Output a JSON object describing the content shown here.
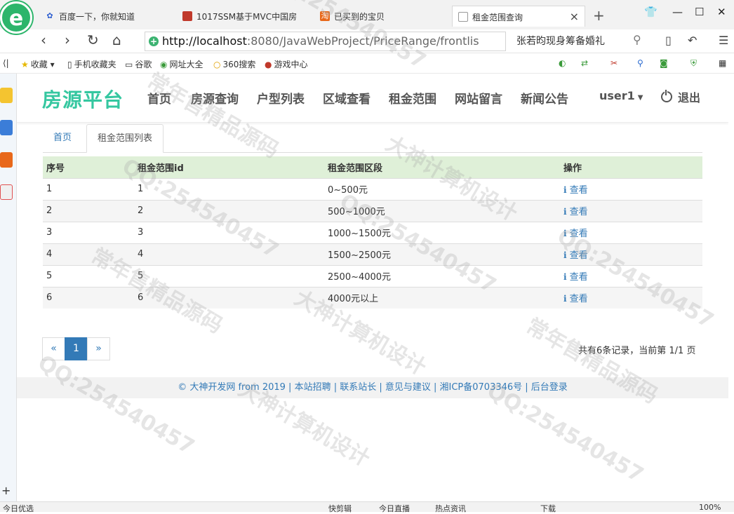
{
  "browser": {
    "tabs": [
      {
        "title": "百度一下，你就知道",
        "icon": "baidu-paw-icon"
      },
      {
        "title": "1017SSM基于MVC中国房",
        "icon": "red-square-icon"
      },
      {
        "title": "已买到的宝贝",
        "icon": "taobao-icon"
      },
      {
        "title": "租金范围查询",
        "icon": "page-icon"
      }
    ],
    "url_host": "http://localhost",
    "url_rest": ":8080/JavaWebProject/PriceRange/frontlis",
    "search_text": "张若昀现身筹备婚礼",
    "bookmarks": [
      "收藏",
      "手机收藏夹",
      "谷歌",
      "网址大全",
      "360搜索",
      "游戏中心"
    ],
    "status": [
      "今日优选",
      "快剪辑",
      "今日直播",
      "热点资讯",
      "下载",
      "100%"
    ]
  },
  "site": {
    "brand": "房源平台",
    "menu": [
      "首页",
      "房源查询",
      "户型列表",
      "区域查看",
      "租金范围",
      "网站留言",
      "新闻公告"
    ],
    "user": "user1",
    "logout": "退出"
  },
  "breadcrumb": {
    "home": "首页",
    "current": "租金范围列表"
  },
  "table": {
    "headers": [
      "序号",
      "租金范围id",
      "租金范围区段",
      "操作"
    ],
    "rows": [
      {
        "no": "1",
        "id": "1",
        "range": "0~500元",
        "action": "查看"
      },
      {
        "no": "2",
        "id": "2",
        "range": "500~1000元",
        "action": "查看"
      },
      {
        "no": "3",
        "id": "3",
        "range": "1000~1500元",
        "action": "查看"
      },
      {
        "no": "4",
        "id": "4",
        "range": "1500~2500元",
        "action": "查看"
      },
      {
        "no": "5",
        "id": "5",
        "range": "2500~4000元",
        "action": "查看"
      },
      {
        "no": "6",
        "id": "6",
        "range": "4000元以上",
        "action": "查看"
      }
    ]
  },
  "pagination": {
    "prev": "«",
    "current": "1",
    "next": "»",
    "summary": "共有6条记录，当前第 1/1 页"
  },
  "footer": "© 大神开发网 from 2019 | 本站招聘 | 联系站长 | 意见与建议 | 湘ICP备0703346号 | 后台登录",
  "watermarks": [
    "大神计算机设计",
    "QQ:254540457",
    "常年售精品源码"
  ],
  "colors": {
    "brand": "#35c7a0",
    "link": "#337ab7",
    "table_header": "#dff0d8"
  }
}
